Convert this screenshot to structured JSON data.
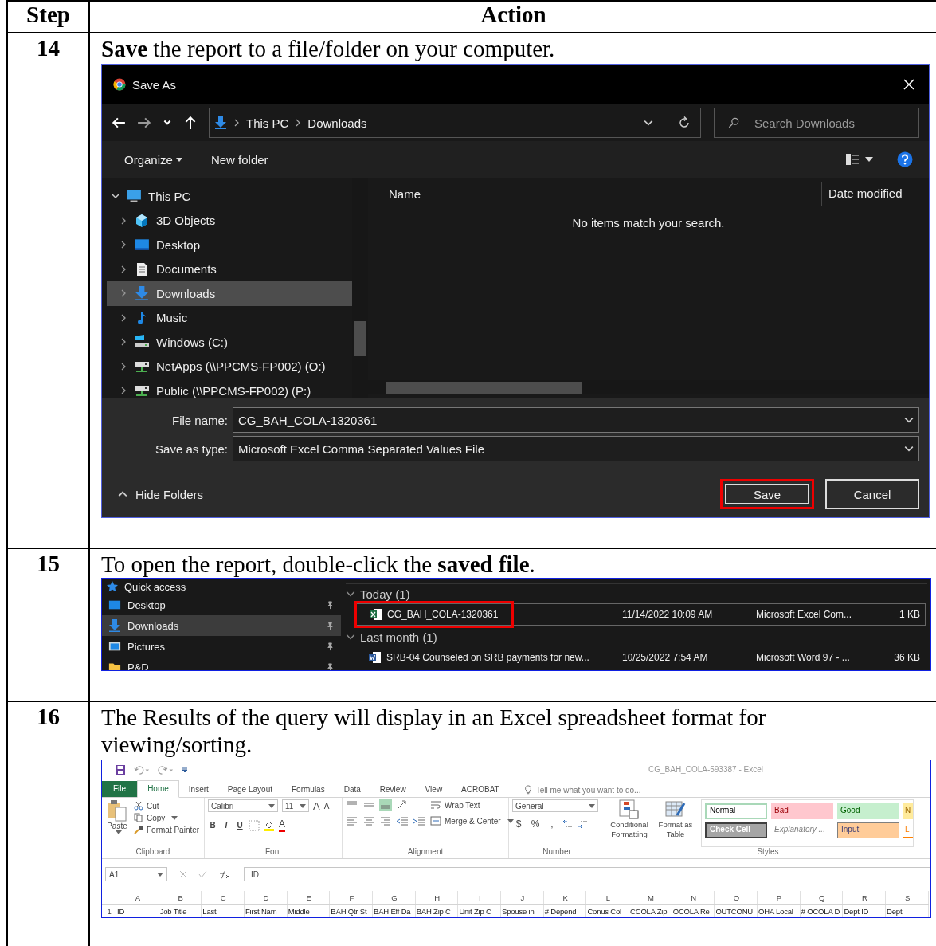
{
  "table": {
    "columns": [
      "Step",
      "Action"
    ],
    "rows": [
      {
        "step": "14",
        "instruction": "**Save** the report to a file/folder on your computer.",
        "kind": "save_dialog"
      },
      {
        "step": "15",
        "instruction": "To open the report, double-click the **saved file**.",
        "kind": "explorer"
      },
      {
        "step": "16",
        "instruction": "The Results of the query will display in an Excel spreadsheet format for viewing/sorting.",
        "kind": "excel"
      }
    ]
  },
  "save_dialog": {
    "title": "Save As",
    "breadcrumb": [
      "This PC",
      "Downloads"
    ],
    "search": {
      "placeholder": "Search Downloads"
    },
    "toolbar": [
      "Organize",
      "New folder"
    ],
    "tree": [
      {
        "label": "This PC",
        "expanded": true,
        "selected": false,
        "children": [
          {
            "label": "3D Objects",
            "expanded": false,
            "selected": false
          },
          {
            "label": "Desktop",
            "expanded": false,
            "selected": false
          },
          {
            "label": "Documents",
            "expanded": false,
            "selected": false
          },
          {
            "label": "Downloads",
            "expanded": false,
            "selected": true
          },
          {
            "label": "Music",
            "expanded": false,
            "selected": false
          },
          {
            "label": "Windows (C:)",
            "expanded": false,
            "selected": false
          },
          {
            "label": "NetApps (\\\\PPCMS-FP002) (O:)",
            "expanded": false,
            "selected": false
          },
          {
            "label": "Public (\\\\PPCMS-FP002) (P:)",
            "expanded": false,
            "selected": false
          }
        ]
      }
    ],
    "list_columns": [
      "Name",
      "Date modified"
    ],
    "empty_message": "No items match your search.",
    "file_name": {
      "label": "File name:",
      "value": "CG_BAH_COLA-1320361"
    },
    "save_type": {
      "label": "Save as type:",
      "value": "Microsoft Excel Comma Separated Values File"
    },
    "hide_folders": "Hide Folders",
    "buttons": [
      {
        "label": "Save",
        "highlighted": true
      },
      {
        "label": "Cancel",
        "highlighted": false
      }
    ]
  },
  "explorer": {
    "sidebar": [
      {
        "label": "Quick access",
        "kind": "header",
        "selected": false,
        "pinned": false
      },
      {
        "label": "Desktop",
        "kind": "item",
        "selected": false,
        "pinned": true
      },
      {
        "label": "Downloads",
        "kind": "item",
        "selected": true,
        "pinned": true
      },
      {
        "label": "Pictures",
        "kind": "item",
        "selected": false,
        "pinned": true
      },
      {
        "label": "P&D",
        "kind": "item",
        "selected": false,
        "pinned": true
      }
    ],
    "groups": [
      {
        "label": "Today (1)",
        "expanded": true,
        "files": [
          {
            "name": "CG_BAH_COLA-1320361",
            "date": "11/14/2022 10:09 AM",
            "type": "Microsoft Excel Com...",
            "size": "1 KB",
            "kind": "excel",
            "selected": true,
            "highlighted": true
          }
        ]
      },
      {
        "label": "Last month (1)",
        "expanded": true,
        "files": [
          {
            "name": "SRB-04 Counseled on SRB payments for new...",
            "date": "10/25/2022 7:54 AM",
            "type": "Microsoft Word 97 - ...",
            "size": "36 KB",
            "kind": "word",
            "selected": false,
            "highlighted": false
          }
        ]
      }
    ]
  },
  "excel": {
    "title": "CG_BAH_COLA-593387  -  Excel",
    "tabs": [
      {
        "label": "File",
        "kind": "file",
        "selected": false
      },
      {
        "label": "Home",
        "kind": "tab",
        "selected": true
      },
      {
        "label": "Insert",
        "kind": "tab",
        "selected": false
      },
      {
        "label": "Page Layout",
        "kind": "tab",
        "selected": false
      },
      {
        "label": "Formulas",
        "kind": "tab",
        "selected": false
      },
      {
        "label": "Data",
        "kind": "tab",
        "selected": false
      },
      {
        "label": "Review",
        "kind": "tab",
        "selected": false
      },
      {
        "label": "View",
        "kind": "tab",
        "selected": false
      },
      {
        "label": "ACROBAT",
        "kind": "tab",
        "selected": false
      }
    ],
    "tell_me": "Tell me what you want to do...",
    "clipboard": {
      "label": "Clipboard",
      "paste": "Paste",
      "cut": "Cut",
      "copy": "Copy",
      "format_painter": "Format Painter"
    },
    "font": {
      "label": "Font",
      "name": "Calibri",
      "size": "11",
      "grow": "A",
      "shrink": "A",
      "bold": "B",
      "italic": "I",
      "underline": "U",
      "font_color_button": "A"
    },
    "alignment": {
      "label": "Alignment",
      "wrap": "Wrap Text",
      "merge": "Merge & Center",
      "vertical_align": [
        {
          "selected": false
        },
        {
          "selected": false
        },
        {
          "selected": true
        }
      ]
    },
    "number": {
      "label": "Number",
      "format": "General",
      "currency": "$",
      "percent": "%",
      "comma": ","
    },
    "styles": {
      "label": "Styles",
      "conditional": "Conditional Formatting",
      "format_table": "Format as Table",
      "cells": [
        {
          "label": "Normal",
          "kind": "normal"
        },
        {
          "label": "Bad",
          "kind": "bad"
        },
        {
          "label": "Good",
          "kind": "good"
        },
        {
          "label": "N",
          "kind": "neutral"
        },
        {
          "label": "Check Cell",
          "kind": "check"
        },
        {
          "label": "Explanatory ...",
          "kind": "explanatory"
        },
        {
          "label": "Input",
          "kind": "input"
        },
        {
          "label": "L",
          "kind": "linked"
        }
      ]
    },
    "name_box": "A1",
    "formula": "ID",
    "columns": [
      "A",
      "B",
      "C",
      "D",
      "E",
      "F",
      "G",
      "H",
      "I",
      "J",
      "K",
      "L",
      "M",
      "N",
      "O",
      "P",
      "Q",
      "R",
      "S"
    ],
    "rows": [
      {
        "number": "1",
        "cells": [
          "ID",
          "Job Title",
          "Last",
          "First Nam",
          "Middle",
          "BAH Qtr St",
          "BAH Eff Da",
          "BAH Zip C",
          "Unit Zip C",
          "Spouse in",
          "# Depend",
          "Conus Col",
          "CCOLA Zip",
          "OCOLA Re",
          "OUTCONU",
          "OHA Local",
          "# OCOLA D",
          "Dept ID",
          "Dept"
        ]
      }
    ]
  }
}
